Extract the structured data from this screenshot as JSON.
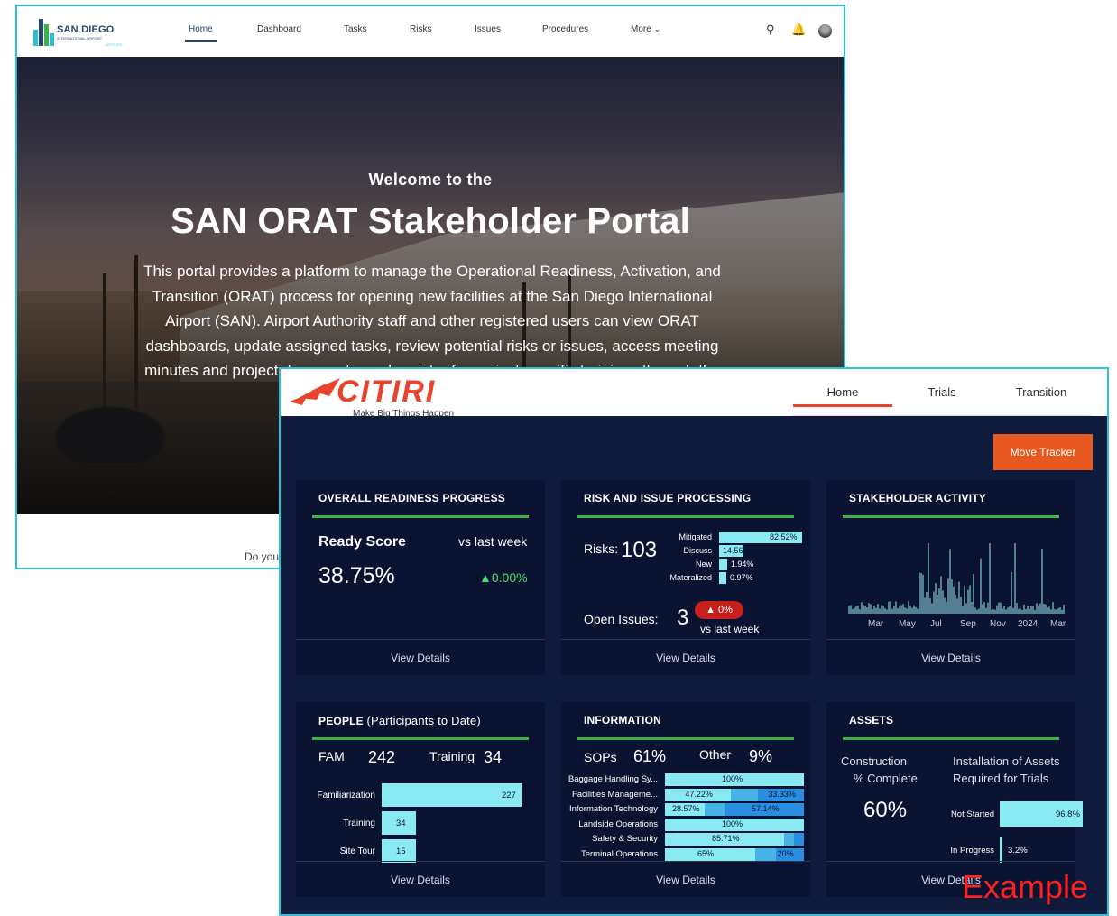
{
  "portal": {
    "brand": "SAN DIEGO",
    "brand_sub": "INTERNATIONAL AIRPORT",
    "brand_tag": "LET'S GO.",
    "nav": [
      "Home",
      "Dashboard",
      "Tasks",
      "Risks",
      "Issues",
      "Procedures",
      "More"
    ],
    "welcome": "Welcome to the",
    "title": "SAN ORAT Stakeholder Portal",
    "description": "This portal provides a platform to manage the Operational Readiness, Activation, and Transition (ORAT) process for opening new facilities at the San Diego International Airport (SAN). Airport Authority staff and other registered users can view ORAT dashboards, update assigned tasks, review potential risks or issues, access meeting minutes and project documents, and register for project-specific trainings through the portal. For questi",
    "footer_question": "Do you"
  },
  "citiri": {
    "brand": "CITIRI",
    "tagline": "Make Big Things Happen",
    "tabs": [
      "Home",
      "Trials",
      "Transition"
    ],
    "move_tracker": "Move Tracker",
    "view_details": "View Details",
    "readiness": {
      "title": "OVERALL READINESS PROGRESS",
      "score_label": "Ready Score",
      "vs_label": "vs last week",
      "score": "38.75%",
      "change": "▲0.00%"
    },
    "risk": {
      "title": "RISK AND ISSUE PROCESSING",
      "risks_label": "Risks:",
      "risks_value": "103",
      "bars": [
        {
          "label": "Mitigated",
          "value": "82.52%",
          "pct": 82.52
        },
        {
          "label": "Discuss",
          "value": "14.56%",
          "pct": 14.56
        },
        {
          "label": "New",
          "value": "1.94%",
          "pct": 1.94
        },
        {
          "label": "Materalized",
          "value": "0.97%",
          "pct": 0.97
        }
      ],
      "issues_label": "Open Issues:",
      "issues_value": "3",
      "badge": "▲ 0%",
      "vs_label": "vs last week"
    },
    "activity": {
      "title": "STAKEHOLDER ACTIVITY",
      "x_labels": [
        "Mar",
        "May",
        "Jul",
        "Sep",
        "Nov",
        "2024",
        "Mar"
      ]
    },
    "people": {
      "title": "PEOPLE",
      "title_light": "(Participants to Date)",
      "fam_label": "FAM",
      "fam_value": "242",
      "training_label": "Training",
      "training_value": "34",
      "bars": [
        {
          "label": "Familiarization",
          "value": "227",
          "n": 227
        },
        {
          "label": "Training",
          "value": "34",
          "n": 34
        },
        {
          "label": "Site Tour",
          "value": "15",
          "n": 15
        }
      ]
    },
    "information": {
      "title": "INFORMATION",
      "sops_label": "SOPs",
      "sops_value": "61%",
      "other_label": "Other",
      "other_value": "9%",
      "rows": [
        {
          "label": "Baggage Handling Sy...",
          "segs": [
            {
              "pct": 100,
              "text": "100%"
            }
          ]
        },
        {
          "label": "Facilities Manageme...",
          "segs": [
            {
              "pct": 47.22,
              "text": "47.22%"
            },
            {
              "pct": 19.45,
              "text": ""
            },
            {
              "pct": 33.33,
              "text": "33.33%"
            }
          ]
        },
        {
          "label": "Information Technology",
          "segs": [
            {
              "pct": 28.57,
              "text": "28.57%"
            },
            {
              "pct": 14.29,
              "text": ""
            },
            {
              "pct": 57.14,
              "text": "57.14%"
            }
          ]
        },
        {
          "label": "Landside Operations",
          "segs": [
            {
              "pct": 100,
              "text": "100%"
            }
          ]
        },
        {
          "label": "Safety & Security",
          "segs": [
            {
              "pct": 85.71,
              "text": "85.71%"
            },
            {
              "pct": 7.14,
              "text": ""
            },
            {
              "pct": 7.15,
              "text": ""
            }
          ]
        },
        {
          "label": "Terminal Operations",
          "segs": [
            {
              "pct": 65,
              "text": "65%"
            },
            {
              "pct": 15,
              "text": ""
            },
            {
              "pct": 20,
              "text": "20%"
            }
          ]
        }
      ],
      "seg_colors": [
        "#8aeaf3",
        "#48b4e6",
        "#2a8ee0"
      ]
    },
    "assets": {
      "title": "ASSETS",
      "construction_label": "Construction",
      "complete_label": "% Complete",
      "installation_label": "Installation of Assets",
      "required_label": "Required for Trials",
      "construction_value": "60%",
      "bars": [
        {
          "label": "Not Started",
          "value": "96.8%",
          "pct": 96.8
        },
        {
          "label": "In Progress",
          "value": "3.2%",
          "pct": 3.2
        }
      ]
    }
  },
  "watermark": "Example"
}
